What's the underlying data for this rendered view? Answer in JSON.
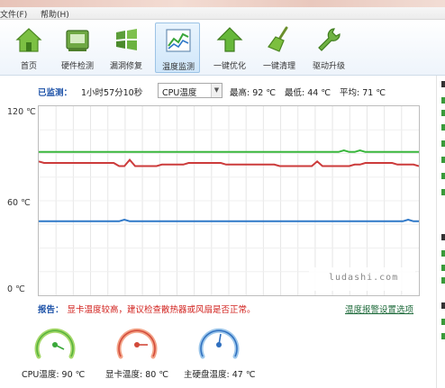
{
  "menu": [
    "文件(F)",
    "帮助(H)"
  ],
  "toolbar": {
    "items": [
      {
        "label": "首页",
        "icon": "home-icon"
      },
      {
        "label": "硬件检测",
        "icon": "hardware-icon"
      },
      {
        "label": "漏洞修复",
        "icon": "windows-patch-icon"
      },
      {
        "label": "温度监测",
        "icon": "temperature-chart-icon",
        "active": true
      },
      {
        "label": "一键优化",
        "icon": "optimize-arrow-icon"
      },
      {
        "label": "一键清理",
        "icon": "broom-icon"
      },
      {
        "label": "驱动升级",
        "icon": "wrench-icon"
      }
    ]
  },
  "status": {
    "monitored_label": "已监测：",
    "monitored_value": "1小时57分10秒",
    "select_value": "CPU温度",
    "max": "最高: 92 ℃",
    "min": "最低: 44 ℃",
    "avg": "平均: 71 ℃"
  },
  "y_labels": [
    "120 ℃",
    "60 ℃",
    "0 ℃"
  ],
  "watermark": "ludashi.com",
  "colors": {
    "cpu": "#38b63c",
    "gpu": "#cc3b3b",
    "disk": "#2f78c8",
    "link": "#1d52a8",
    "alert": "#d1201c"
  },
  "chart_data": {
    "type": "line",
    "title": "",
    "ylim": [
      0,
      120
    ],
    "y_ticks": [
      0,
      60,
      120
    ],
    "grid": true,
    "series": [
      {
        "values": [
          91,
          91,
          91,
          91,
          91,
          91,
          91,
          91,
          91,
          91,
          91,
          91,
          91,
          91,
          91,
          91,
          91,
          91,
          91,
          91,
          91,
          91,
          91,
          91,
          91,
          91,
          91,
          91,
          91,
          91,
          91,
          91,
          91,
          91,
          91,
          91,
          91,
          91,
          91,
          91,
          91,
          91,
          91,
          91,
          91,
          91,
          91,
          91,
          91,
          91,
          91,
          91,
          91,
          91,
          91,
          91,
          91,
          92,
          91,
          91,
          92,
          91,
          91,
          91,
          91,
          91,
          91,
          91,
          91,
          91,
          91,
          91
        ]
      },
      {
        "values": [
          85,
          84,
          84,
          84,
          84,
          84,
          84,
          84,
          84,
          84,
          84,
          84,
          84,
          84,
          84,
          82,
          82,
          86,
          82,
          82,
          82,
          82,
          82,
          83,
          83,
          83,
          83,
          83,
          84,
          84,
          84,
          84,
          84,
          84,
          84,
          83,
          83,
          83,
          83,
          83,
          83,
          83,
          83,
          83,
          83,
          82,
          82,
          82,
          82,
          82,
          82,
          82,
          85,
          82,
          82,
          82,
          82,
          82,
          82,
          83,
          83,
          84,
          84,
          84,
          84,
          84,
          84,
          83,
          83,
          83,
          83,
          82
        ]
      },
      {
        "values": [
          47,
          47,
          47,
          47,
          47,
          47,
          47,
          47,
          47,
          47,
          47,
          47,
          47,
          47,
          47,
          47,
          48,
          47,
          47,
          47,
          47,
          47,
          47,
          47,
          47,
          47,
          47,
          47,
          47,
          47,
          47,
          47,
          47,
          47,
          47,
          47,
          47,
          47,
          47,
          47,
          47,
          47,
          47,
          47,
          47,
          47,
          47,
          47,
          47,
          47,
          47,
          47,
          47,
          47,
          47,
          47,
          47,
          47,
          47,
          47,
          47,
          47,
          47,
          47,
          47,
          47,
          47,
          47,
          47,
          48,
          47,
          47
        ]
      }
    ]
  },
  "report": {
    "label": "报告：",
    "message": "显卡温度较高，建议检查散热器或风扇是否正常。"
  },
  "settings_link": "温度报警设置选项",
  "gauges": [
    {
      "label": "CPU温度: 90 ℃",
      "value": 90,
      "color": "#3aa83a",
      "ring_color": "#a6d86a"
    },
    {
      "label": "显卡温度: 80 ℃",
      "value": 80,
      "color": "#d24a3a",
      "ring_color": "#f3a488"
    },
    {
      "label": "主硬盘温度: 47 ℃",
      "value": 47,
      "color": "#2f6fbf",
      "ring_color": "#9cc6ea"
    }
  ]
}
